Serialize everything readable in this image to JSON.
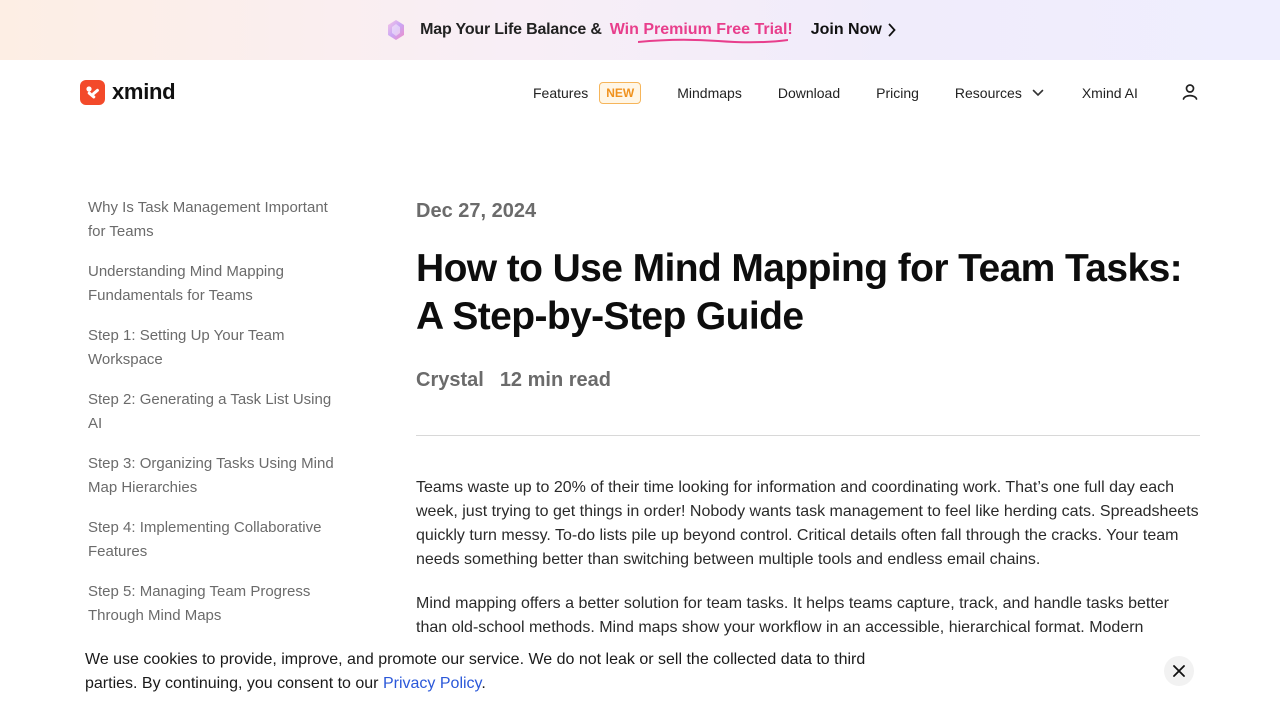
{
  "promo": {
    "text": "Map Your Life Balance &",
    "highlight": "Win Premium Free Trial!",
    "cta": "Join Now",
    "highlight_color": "#e83e8c"
  },
  "header": {
    "logo_text": "xmind",
    "brand_color": "#f34a2a",
    "nav": {
      "features": "Features",
      "features_badge": "NEW",
      "mindmaps": "Mindmaps",
      "download": "Download",
      "pricing": "Pricing",
      "resources": "Resources",
      "xmind_ai": "Xmind AI"
    },
    "icons": {
      "resources_dropdown": "chevron-down-icon",
      "account": "user-icon"
    }
  },
  "toc": {
    "items": [
      "Why Is Task Management Important for Teams",
      "Understanding Mind Mapping Fundamentals for Teams",
      "Step 1: Setting Up Your Team Workspace",
      "Step 2: Generating a Task List Using AI",
      "Step 3: Organizing Tasks Using Mind Map Hierarchies",
      "Step 4: Implementing Collaborative Features",
      "Step 5: Managing Team Progress Through Mind Maps"
    ]
  },
  "article": {
    "date": "Dec 27, 2024",
    "title": "How to Use Mind Mapping for Team Tasks: A Step-by-Step Guide",
    "author": "Crystal",
    "read_time": "12 min read",
    "paragraphs": [
      "Teams waste up to 20% of their time looking for information and coordinating work. That’s one full day each week, just trying to get things in order! Nobody wants task management to feel like herding cats. Spreadsheets quickly turn messy. To-do lists pile up beyond control. Critical details often fall through the cracks. Your team needs something better than switching between multiple tools and endless email chains.",
      "Mind mapping offers a better solution for team tasks. It helps teams capture, track, and handle tasks better than old-school methods. Mind maps show your workflow in an accessible, hierarchical format. Modern"
    ]
  },
  "cookie": {
    "text": "We use cookies to provide, improve, and promote our service. We do not leak or sell the collected data to third parties. By continuing, you consent to our",
    "link": "Privacy Policy",
    "suffix": ".",
    "link_color": "#2b58d9"
  }
}
